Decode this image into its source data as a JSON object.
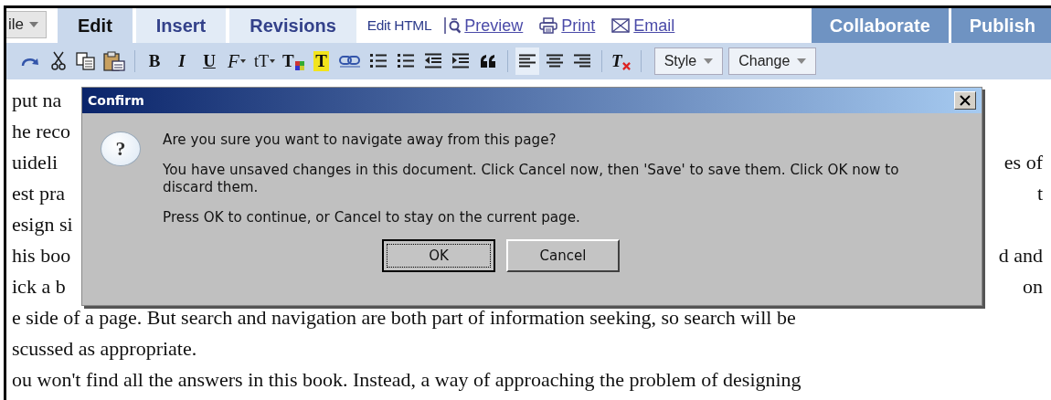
{
  "menu_button": {
    "label": "ile"
  },
  "tabs": [
    {
      "label": "Edit",
      "selected": true
    },
    {
      "label": "Insert",
      "selected": false
    },
    {
      "label": "Revisions",
      "selected": false
    }
  ],
  "links": [
    {
      "kind": "plain",
      "label": "Edit HTML"
    },
    {
      "kind": "preview",
      "label": "Preview"
    },
    {
      "kind": "print",
      "label": "Print"
    },
    {
      "kind": "email",
      "label": "Email"
    }
  ],
  "section_tabs": [
    {
      "label": "Collaborate"
    },
    {
      "label": "Publish"
    }
  ],
  "toolbar": {
    "groups": [
      [
        {
          "kind": "redo"
        },
        {
          "kind": "cut"
        },
        {
          "kind": "copy"
        },
        {
          "kind": "paste"
        }
      ],
      [
        {
          "kind": "bold",
          "label": "B"
        },
        {
          "kind": "italic",
          "label": "I"
        },
        {
          "kind": "underline",
          "label": "U"
        },
        {
          "kind": "font",
          "label": "F"
        },
        {
          "kind": "size",
          "label": "tT"
        },
        {
          "kind": "text-color",
          "label": "T"
        },
        {
          "kind": "highlight",
          "label": "T"
        },
        {
          "kind": "link"
        },
        {
          "kind": "numbered-list"
        },
        {
          "kind": "bullet-list"
        },
        {
          "kind": "outdent"
        },
        {
          "kind": "indent"
        },
        {
          "kind": "quote"
        }
      ],
      [
        {
          "kind": "align-left",
          "selected": true
        },
        {
          "kind": "align-center",
          "selected": false
        },
        {
          "kind": "align-right",
          "selected": false
        }
      ],
      [
        {
          "kind": "clear-format",
          "label": "T"
        }
      ]
    ],
    "dropdowns": [
      {
        "label": "Style"
      },
      {
        "label": "Change"
      }
    ]
  },
  "document": {
    "lines": [
      {
        "left": "put na"
      },
      {
        "left": "he reco"
      },
      {
        "left": "uideli",
        "right": "es of"
      },
      {
        "left": "est pra",
        "right": "t"
      },
      {
        "left": "esign si"
      },
      {
        "left": "his boo",
        "right": "d and"
      },
      {
        "left": "ick a b",
        "right": "on"
      },
      {
        "left": "e side of a page. But search and navigation are both part of information seeking, so search will be"
      },
      {
        "left": "scussed as appropriate."
      },
      {
        "left": "ou won't find all the answers in this book. Instead, a way of approaching the problem of designing"
      }
    ]
  },
  "dialog": {
    "title": "Confirm",
    "icon_text": "?",
    "messages": [
      "Are you sure you want to navigate away from this page?",
      "You have unsaved changes in this document. Click Cancel now, then 'Save' to save them. Click OK now to discard them.",
      "Press OK to continue, or Cancel to stay on the current page."
    ],
    "buttons": [
      {
        "label": "OK",
        "focused": true
      },
      {
        "label": "Cancel",
        "focused": false
      }
    ]
  }
}
